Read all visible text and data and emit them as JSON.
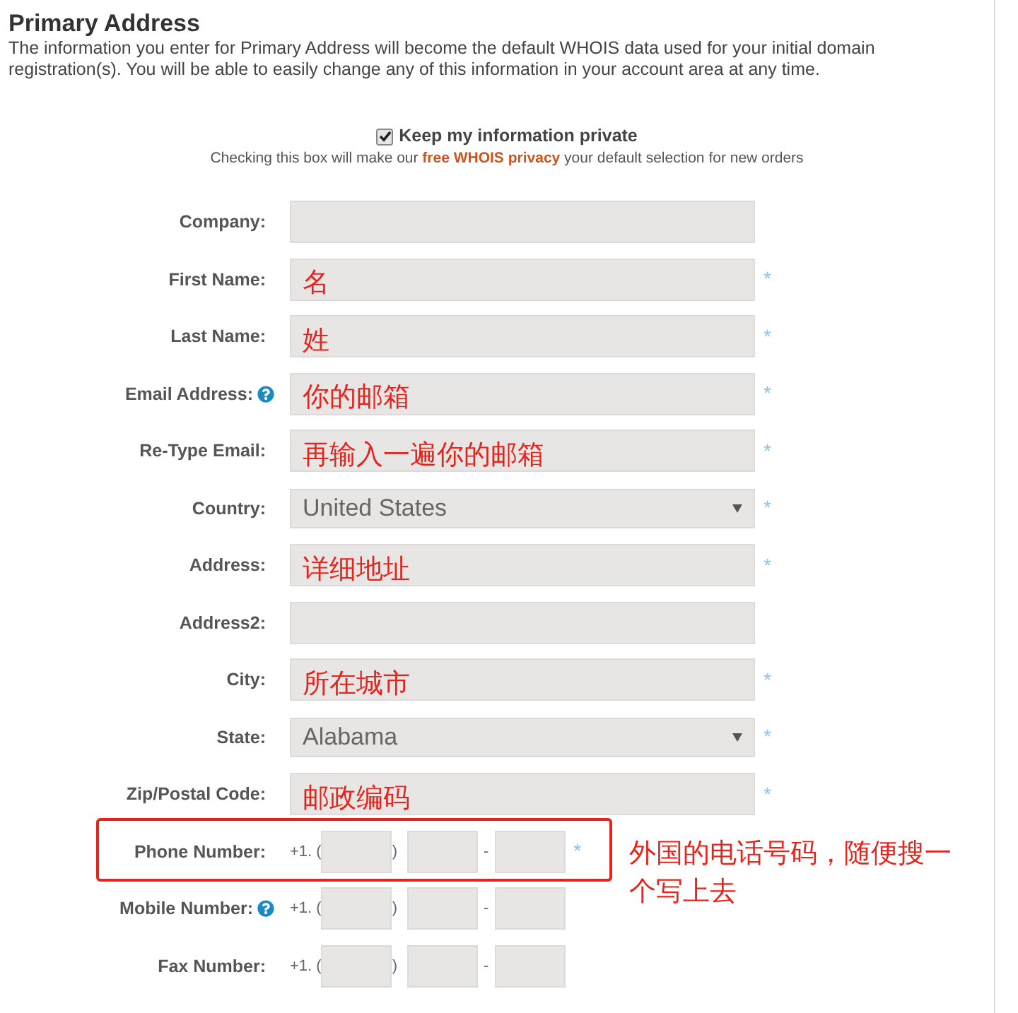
{
  "title": "Primary Address",
  "intro": "The information you enter for Primary Address will become the default WHOIS data used for your initial domain registration(s). You will be able to easily change any of this information in your account area at any time.",
  "privacy": {
    "checked": true,
    "label": "Keep my information private",
    "note_before": "Checking this box will make our",
    "link": "free WHOIS privacy",
    "note_after": "your default selection for new orders"
  },
  "fields": [
    {
      "kind": "text",
      "label": "Company:"
    },
    {
      "kind": "text",
      "label": "First Name:",
      "required_mark": "*",
      "annotation": "名"
    },
    {
      "kind": "text",
      "label": "Last Name:",
      "required_mark": "*",
      "annotation": "姓"
    },
    {
      "kind": "text",
      "label": "Email Address:",
      "required_mark": "*",
      "help": true,
      "annotation": "你的邮箱"
    },
    {
      "kind": "text",
      "label": "Re-Type Email:",
      "required_mark": "*",
      "annotation": "再输入一遍你的邮箱"
    },
    {
      "kind": "select",
      "label": "Country:",
      "required_mark": "*",
      "value": "United States"
    },
    {
      "kind": "text",
      "label": "Address:",
      "required_mark": "*",
      "annotation": "详细地址"
    },
    {
      "kind": "text",
      "label": "Address2:"
    },
    {
      "kind": "text",
      "label": "City:",
      "required_mark": "*",
      "annotation": "所在城市"
    },
    {
      "kind": "select",
      "label": "State:",
      "required_mark": "*",
      "value": "Alabama"
    },
    {
      "kind": "text",
      "label": "Zip/Postal Code:",
      "required_mark": "*",
      "annotation": "邮政编码"
    },
    {
      "kind": "phone",
      "label": "Phone Number:",
      "required_mark": "*",
      "prefix": "+1. (",
      "close": ")",
      "dash": "-",
      "highlighted": true,
      "note_lines": [
        "外国的电话号码，随便搜一",
        "个写上去"
      ]
    },
    {
      "kind": "phone",
      "label": "Mobile Number:",
      "help": true,
      "prefix": "+1. (",
      "close": ")",
      "dash": "-"
    },
    {
      "kind": "phone",
      "label": "Fax Number:",
      "prefix": "+1. (",
      "close": ")",
      "dash": "-"
    }
  ]
}
